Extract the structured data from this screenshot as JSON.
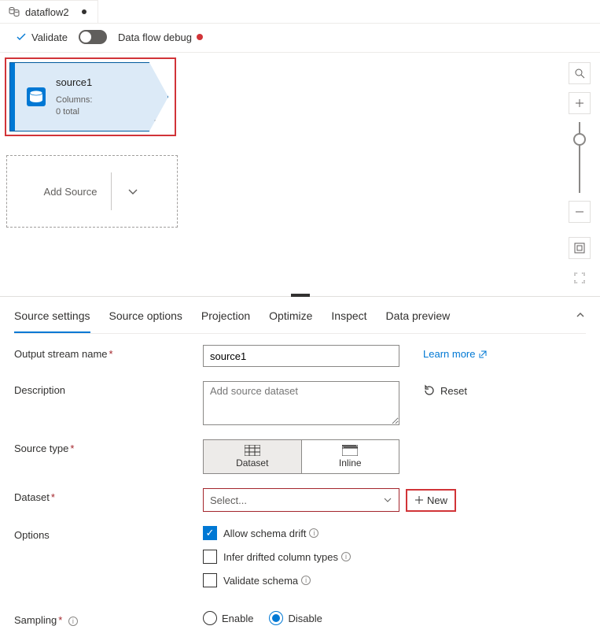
{
  "tab": {
    "name": "dataflow2"
  },
  "toolbar": {
    "validate": "Validate",
    "debug_label": "Data flow debug"
  },
  "canvas": {
    "source": {
      "title": "source1",
      "columns_label": "Columns:",
      "columns_count": "0 total"
    },
    "add_source": "Add Source"
  },
  "panel": {
    "tabs": [
      "Source settings",
      "Source options",
      "Projection",
      "Optimize",
      "Inspect",
      "Data preview"
    ]
  },
  "form": {
    "output_stream_label": "Output stream name",
    "output_stream_value": "source1",
    "learn_more": "Learn more",
    "description_label": "Description",
    "description_placeholder": "Add source dataset",
    "reset": "Reset",
    "source_type_label": "Source type",
    "source_type_options": {
      "dataset": "Dataset",
      "inline": "Inline"
    },
    "dataset_label": "Dataset",
    "dataset_placeholder": "Select...",
    "new_button": "New",
    "options_label": "Options",
    "options": {
      "allow_schema_drift": "Allow schema drift",
      "infer_drifted": "Infer drifted column types",
      "validate_schema": "Validate schema"
    },
    "sampling_label": "Sampling",
    "sampling": {
      "enable": "Enable",
      "disable": "Disable"
    }
  }
}
